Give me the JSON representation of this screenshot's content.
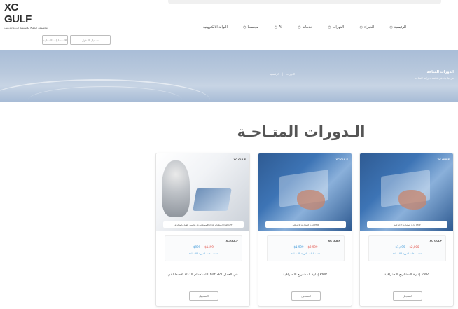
{
  "header": {
    "brand_name": "XC GULF",
    "brand_tagline": "مجموعة الخليج للاستشارات والتدريب",
    "nav": [
      {
        "label": "الرئيسية",
        "icon": "home-icon"
      },
      {
        "label": "الخبراء",
        "icon": "users-icon"
      },
      {
        "label": "الدورات",
        "icon": "book-icon"
      },
      {
        "label": "خدماتنا",
        "icon": "briefcase-icon"
      },
      {
        "label": "AI",
        "icon": "chip-icon"
      },
      {
        "label": "مجتمعنا",
        "icon": "globe-icon"
      },
      {
        "label": "البوابة الالكترونية",
        "icon": "portal-icon"
      }
    ],
    "buttons": [
      {
        "label": "تسجيل الدخول"
      },
      {
        "label": "الاستشارات المجانية"
      }
    ]
  },
  "hero": {
    "title": "الدورات المتاحة",
    "subtitle": "مرحبا بك في قائمة دوراتنا المتاحة",
    "breadcrumb": [
      "الرئيسية",
      "الدورات"
    ]
  },
  "section": {
    "title": "الـدورات المتـاحـة"
  },
  "cards": [
    {
      "image": "ai-robot-image",
      "logo": "XC GULF",
      "band": "استخدام الذكاء الاصطناعي في تحسين العمل باستخدام ChatGPT",
      "badge": "XC GULF",
      "price_new": "$999",
      "price_old": "$1499",
      "hours": "عدد ساعات الدورة 40 ساعة",
      "title": "استخدام الذكاء الاصطناعي ChatGPT في العمل",
      "button": "التسجيل"
    },
    {
      "image": "pmp-desk-image",
      "logo": "XC GULF",
      "band": "إدارة المشاريع الاحترافية PMP",
      "badge": "XC GULF",
      "price_new": "$1,999",
      "price_old": "$2,999",
      "hours": "عدد ساعات الدورة 40 ساعة",
      "title": "إدارة المشاريع الاحترافية PMP",
      "button": "التسجيل"
    },
    {
      "image": "pmp-desk-image",
      "logo": "XC GULF",
      "band": "إدارة المشاريع الاحترافية PMP",
      "badge": "XC GULF",
      "price_new": "$1,499",
      "price_old": "$2,000",
      "hours": "عدد ساعات الدورة 40 ساعة",
      "title": "إدارة المشاريع الاحترافية PMP",
      "button": "التسجيل"
    }
  ]
}
